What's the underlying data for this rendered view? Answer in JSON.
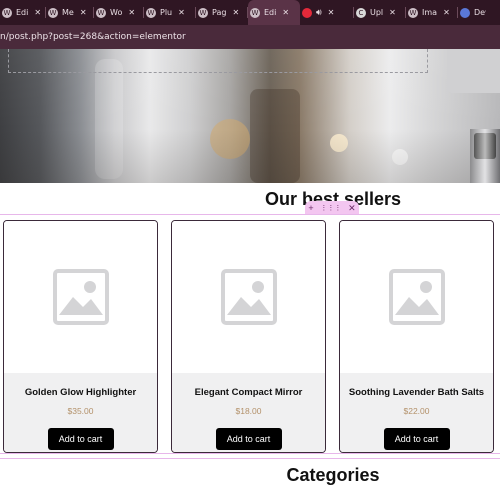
{
  "browser": {
    "tabs": [
      {
        "label": "Edi",
        "favicon": "wordpress-icon",
        "active": false
      },
      {
        "label": "Me",
        "favicon": "wordpress-icon",
        "active": false
      },
      {
        "label": "Wo",
        "favicon": "wordpress-icon",
        "active": false
      },
      {
        "label": "Plu",
        "favicon": "wordpress-icon",
        "active": false
      },
      {
        "label": "Pag",
        "favicon": "wordpress-icon",
        "active": false
      },
      {
        "label": "Edi",
        "favicon": "wordpress-icon",
        "active": true
      },
      {
        "label": "",
        "favicon": "youtube-icon",
        "active": false
      },
      {
        "label": "Upl",
        "favicon": "c-icon",
        "active": false
      },
      {
        "label": "Ima",
        "favicon": "wordpress-icon",
        "active": false
      },
      {
        "label": "Dev",
        "favicon": "dev-icon",
        "active": false
      }
    ],
    "close_glyph": "✕",
    "url": "n/post.php?post=268&action=elementor"
  },
  "page": {
    "best_sellers_title": "Our best sellers",
    "categories_title": "Categories",
    "widget_handle": {
      "add": "+",
      "move": "⋮⋮⋮",
      "close": "✕"
    },
    "products": [
      {
        "name": "Golden Glow Highlighter",
        "price": "$35.00",
        "button": "Add to cart"
      },
      {
        "name": "Elegant Compact Mirror",
        "price": "$18.00",
        "button": "Add to cart"
      },
      {
        "name": "Soothing Lavender Bath Salts",
        "price": "$22.00",
        "button": "Add to cart"
      }
    ]
  },
  "colors": {
    "tabbar": "#2f1623",
    "urlbar": "#4a2a3b",
    "price": "#b3916a",
    "button": "#000000",
    "editor_outline": "#e7b7ea"
  }
}
